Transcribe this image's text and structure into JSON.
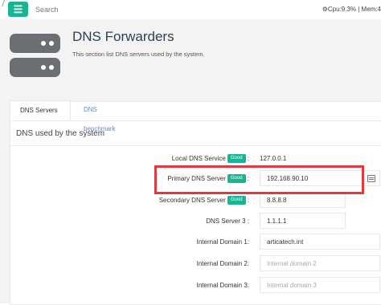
{
  "topbar": {
    "menu_icon": "hamburger-icon",
    "search_placeholder": "Search",
    "status_text": "⚙Cpu:9.3% | Mem:4"
  },
  "header": {
    "title": "DNS Forwarders",
    "subtitle": "This section list DNS servers used by the system."
  },
  "tabs": [
    {
      "label": "DNS Servers",
      "active": true
    },
    {
      "label": "DNS benchmark",
      "active": false
    }
  ],
  "section_title": "DNS used by the system",
  "badge_text": "Good",
  "rows": {
    "local_dns": {
      "label": "Local DNS Service",
      "value": "127.0.0.1"
    },
    "primary_dns": {
      "label": "Primary DNS Server",
      "value": "192.168.90.10"
    },
    "secondary_dns": {
      "label": "Secondary DNS Server",
      "value": "8.8.8.8"
    },
    "dns3": {
      "label": "DNS Server 3 :",
      "value": "1.1.1.1"
    },
    "domain1": {
      "label": "Internal Domain 1:",
      "value": "articatech.int"
    },
    "domain2": {
      "label": "Internal Domain 2:",
      "placeholder": "Internal domain 2"
    },
    "domain3": {
      "label": "Internal Domain 3:",
      "placeholder": "Internal domain 3"
    }
  },
  "colors": {
    "accent": "#1ab394",
    "highlight": "#e0393e"
  }
}
